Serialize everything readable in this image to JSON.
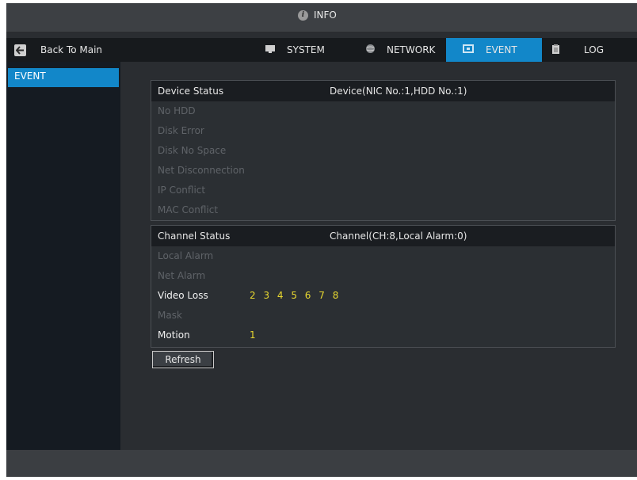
{
  "window": {
    "title": "INFO",
    "title_icon": "info-icon"
  },
  "toolbar": {
    "back_label": "Back To Main",
    "back_icon": "back-arrow-icon",
    "tabs": [
      {
        "label": "SYSTEM",
        "icon": "monitor-icon",
        "active": false
      },
      {
        "label": "NETWORK",
        "icon": "globe-icon",
        "active": false
      },
      {
        "label": "EVENT",
        "icon": "event-icon",
        "active": true
      },
      {
        "label": "LOG",
        "icon": "clipboard-icon",
        "active": false
      }
    ]
  },
  "sidebar": {
    "items": [
      {
        "label": "EVENT",
        "active": true
      }
    ]
  },
  "device_status": {
    "header_label": "Device Status",
    "header_value": "Device(NIC No.:1,HDD No.:1)",
    "rows": [
      {
        "label": "No HDD",
        "value": ""
      },
      {
        "label": "Disk Error",
        "value": ""
      },
      {
        "label": "Disk No Space",
        "value": ""
      },
      {
        "label": "Net Disconnection",
        "value": ""
      },
      {
        "label": "IP Conflict",
        "value": ""
      },
      {
        "label": "MAC Conflict",
        "value": ""
      }
    ]
  },
  "channel_status": {
    "header_label": "Channel Status",
    "header_value": "Channel(CH:8,Local Alarm:0)",
    "rows": [
      {
        "label": "Local Alarm",
        "value": ""
      },
      {
        "label": "Net Alarm",
        "value": ""
      },
      {
        "label": "Video Loss",
        "value": "2 3 4 5 6 7 8"
      },
      {
        "label": "Mask",
        "value": ""
      },
      {
        "label": "Motion",
        "value": "1"
      }
    ]
  },
  "actions": {
    "refresh_label": "Refresh"
  },
  "colors": {
    "accent": "#1287c9",
    "value_highlight": "#e8d830",
    "inactive_text": "#5f6368",
    "background": "#2a2d31"
  }
}
